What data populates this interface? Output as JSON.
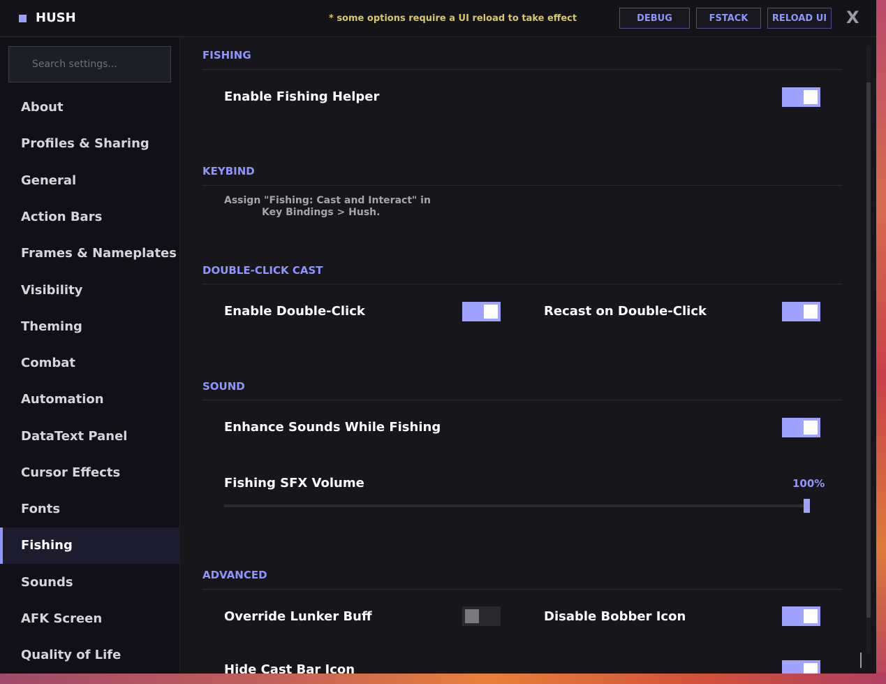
{
  "app": {
    "title": "HUSH",
    "notice": "* some options require a UI reload to take effect"
  },
  "toolbar": {
    "debug_label": "DEBUG",
    "fstack_label": "FSTACK",
    "reload_label": "RELOAD UI",
    "close_label": "X"
  },
  "search": {
    "placeholder": "Search settings..."
  },
  "sidebar": {
    "items": [
      {
        "label": "About"
      },
      {
        "label": "Profiles & Sharing"
      },
      {
        "label": "General"
      },
      {
        "label": "Action Bars"
      },
      {
        "label": "Frames & Nameplates"
      },
      {
        "label": "Visibility"
      },
      {
        "label": "Theming"
      },
      {
        "label": "Combat"
      },
      {
        "label": "Automation"
      },
      {
        "label": "DataText Panel"
      },
      {
        "label": "Cursor Effects"
      },
      {
        "label": "Fonts"
      },
      {
        "label": "Fishing"
      },
      {
        "label": "Sounds"
      },
      {
        "label": "AFK Screen"
      },
      {
        "label": "Quality of Life"
      }
    ],
    "active": "Fishing"
  },
  "sections": {
    "fishing": {
      "title": "FISHING",
      "enable_helper": {
        "label": "Enable Fishing Helper",
        "on": true
      }
    },
    "keybind": {
      "title": "KEYBIND",
      "line1": "Assign \"Fishing: Cast and Interact\" in",
      "line2": "Key Bindings  >  Hush."
    },
    "double_click": {
      "title": "DOUBLE-CLICK CAST",
      "enable": {
        "label": "Enable Double-Click",
        "on": true
      },
      "recast": {
        "label": "Recast on Double-Click",
        "on": true
      }
    },
    "sound": {
      "title": "SOUND",
      "enhance": {
        "label": "Enhance Sounds While Fishing",
        "on": true
      },
      "volume": {
        "label": "Fishing SFX Volume",
        "value_text": "100%",
        "value": 100
      }
    },
    "advanced": {
      "title": "ADVANCED",
      "override_lunker": {
        "label": "Override Lunker Buff",
        "on": false
      },
      "disable_bobber": {
        "label": "Disable Bobber Icon",
        "on": true
      },
      "hide_cast_bar": {
        "label": "Hide Cast Bar Icon",
        "on": true
      }
    }
  },
  "colors": {
    "accent": "#8f95ff",
    "toggle_on": "#9fa3ff",
    "notice": "#d9c766"
  }
}
